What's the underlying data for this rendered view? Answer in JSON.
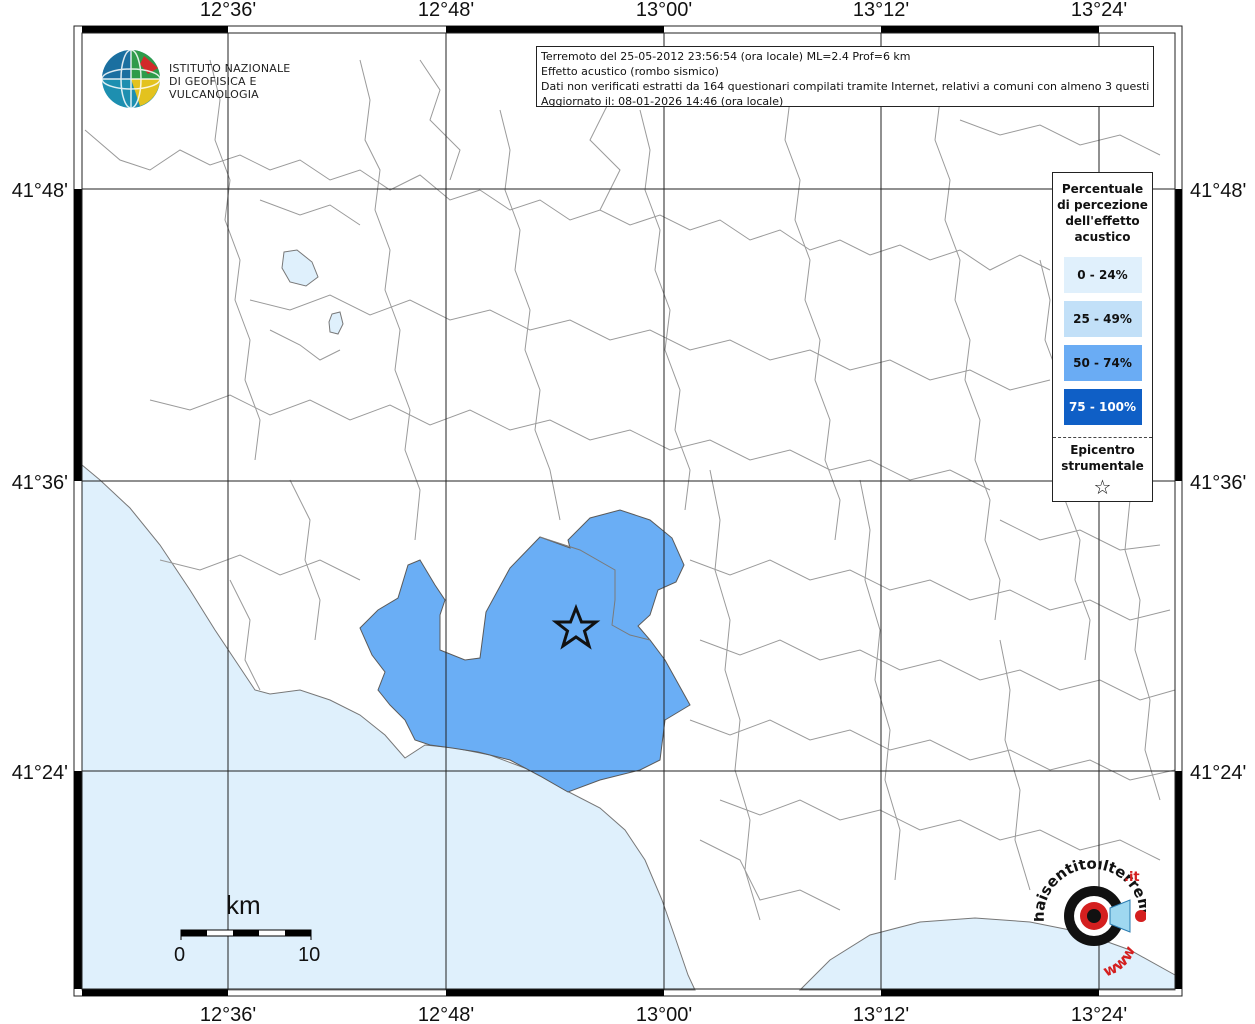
{
  "info": {
    "line1": "Terremoto del 25-05-2012 23:56:54 (ora locale) ML=2.4 Prof=6 km",
    "line2": "Effetto acustico (rombo sismico)",
    "line3": "Dati non verificati estratti da 164 questionari compilati tramite Internet, relativi a comuni con almeno 3 questionari.",
    "line4": "Aggiornato il: 08-01-2026 14:46 (ora locale)"
  },
  "ingv": {
    "line1": "ISTITUTO NAZIONALE",
    "line2": "DI GEOFISICA E VULCANOLOGIA"
  },
  "axes": {
    "lon_top": [
      "12°36'",
      "12°48'",
      "13°00'",
      "13°12'",
      "13°24'"
    ],
    "lon_bottom": [
      "12°36'",
      "12°48'",
      "13°00'",
      "13°12'",
      "13°24'"
    ],
    "lat_left": [
      "41°48'",
      "41°36'",
      "41°24'"
    ],
    "lat_right": [
      "41°48'",
      "41°36'",
      "41°24'"
    ]
  },
  "legend": {
    "title_1": "Percentuale",
    "title_2": "di percezione",
    "title_3": "dell'effetto",
    "title_4": "acustico",
    "items": [
      {
        "label": "0 - 24%",
        "color": "#e0f0fc"
      },
      {
        "label": "25 - 49%",
        "color": "#c2e0f8"
      },
      {
        "label": "50 - 74%",
        "color": "#6aacf4"
      },
      {
        "label": "75 - 100%",
        "color": "#0f5fc6"
      }
    ],
    "epi_1": "Epicentro",
    "epi_2": "strumentale",
    "epi_symbol": "☆"
  },
  "scale": {
    "unit": "km",
    "start": "0",
    "end": "10"
  },
  "logo": {
    "text_black": "haisentitoilterremoto",
    "text_red": ".it",
    "text_www": "www"
  },
  "colors": {
    "sea": "#dff0fc",
    "affected": "#6aaef5",
    "grid": "#222222",
    "borders": "#9a9a9a"
  }
}
